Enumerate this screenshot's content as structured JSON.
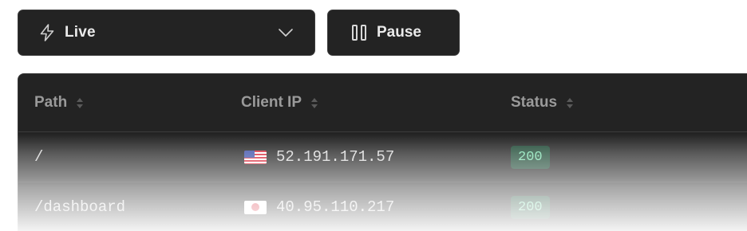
{
  "toolbar": {
    "mode_label": "Live",
    "mode_icon": "bolt-icon",
    "dropdown_icon": "chevron-down-icon",
    "pause_label": "Pause",
    "pause_icon": "pause-icon"
  },
  "table": {
    "columns": [
      {
        "label": "Path"
      },
      {
        "label": "Client IP"
      },
      {
        "label": "Status"
      }
    ],
    "rows": [
      {
        "path": "/",
        "flag": "US",
        "ip": "52.191.171.57",
        "status": "200"
      },
      {
        "path": "/dashboard",
        "flag": "JP",
        "ip": "40.95.110.217",
        "status": "200"
      }
    ]
  },
  "colors": {
    "surface": "#232323",
    "border": "#3a3a3a",
    "status_ok_bg": "#1f4a36",
    "status_ok_text": "#7fe0b0"
  }
}
